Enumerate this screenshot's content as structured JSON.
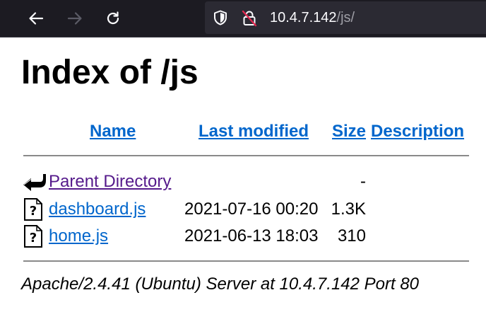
{
  "browser": {
    "url_host": "10.4.7.142",
    "url_path": "/js/",
    "icons": {
      "back": "arrow-left-icon",
      "forward": "arrow-right-icon",
      "reload": "reload-icon",
      "tracking": "shield-icon",
      "insecure": "insecure-lock-icon"
    },
    "forward_enabled": false
  },
  "page": {
    "title": "Index of /js",
    "columns": {
      "name": "Name",
      "last_modified": "Last modified",
      "size": "Size",
      "description": "Description"
    },
    "entries": [
      {
        "name": "Parent Directory",
        "last_modified": "",
        "size": "-",
        "icon": "back-arrow-icon",
        "visited": true
      },
      {
        "name": "dashboard.js",
        "last_modified": "2021-07-16 00:20",
        "size": "1.3K",
        "icon": "unknown-file-icon",
        "visited": false
      },
      {
        "name": "home.js",
        "last_modified": "2021-06-13 18:03",
        "size": "310",
        "icon": "unknown-file-icon",
        "visited": false
      }
    ],
    "address": "Apache/2.4.41 (Ubuntu) Server at 10.4.7.142 Port 80"
  },
  "colors": {
    "link": "#0066cc",
    "visited_link": "#551a8b",
    "toolbar_bg": "#1c1b22",
    "urlbar_bg": "#2b2a33"
  }
}
